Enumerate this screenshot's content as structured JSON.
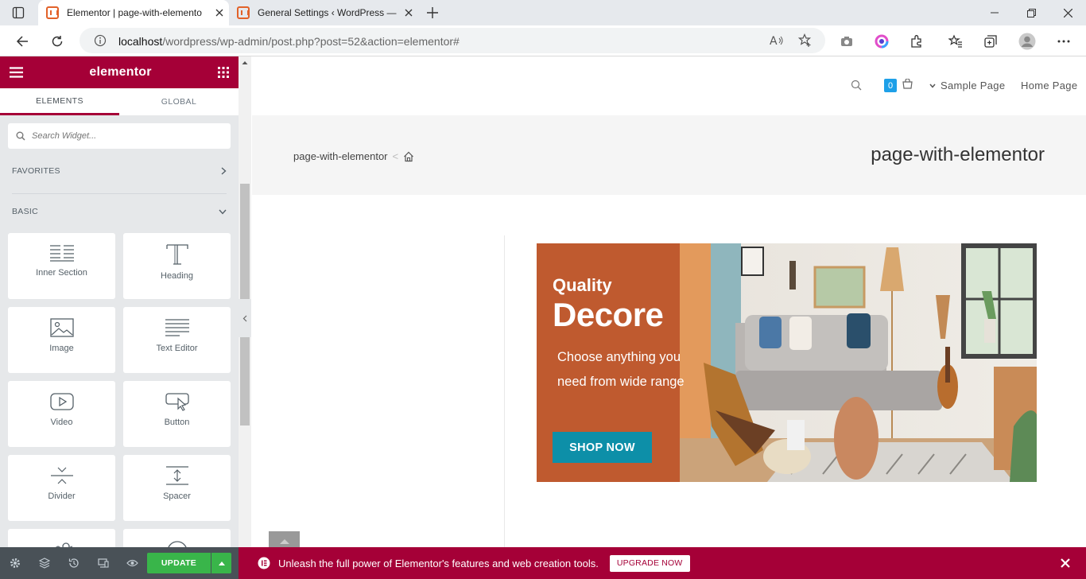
{
  "browser": {
    "tabs": [
      {
        "title": "Elementor | page-with-elemento",
        "active": true
      },
      {
        "title": "General Settings ‹ WordPress — W",
        "active": false
      }
    ],
    "url_host": "localhost",
    "url_rest": "/wordpress/wp-admin/post.php?post=52&action=elementor#"
  },
  "panel": {
    "brand": "elementor",
    "tabs": [
      "ELEMENTS",
      "GLOBAL"
    ],
    "search_placeholder": "Search Widget...",
    "categories": {
      "favorites": "FAVORITES",
      "basic": "BASIC"
    },
    "widgets": [
      "Inner Section",
      "Heading",
      "Image",
      "Text Editor",
      "Video",
      "Button",
      "Divider",
      "Spacer"
    ],
    "update_label": "UPDATE"
  },
  "site": {
    "cart_count": "0",
    "nav": [
      "Sample Page",
      "Home Page"
    ],
    "breadcrumb": "page-with-elementor",
    "breadcrumb_sep": "<",
    "page_title": "page-with-elementor"
  },
  "banner": {
    "kicker": "Quality",
    "headline": "Decore",
    "text": "Choose anything you need from wide range",
    "cta": "SHOP NOW"
  },
  "promo": {
    "text": "Unleash the full power of Elementor's features and web creation tools.",
    "cta": "UPGRADE NOW"
  },
  "colors": {
    "accent": "#a50037",
    "update": "#39b54a",
    "banner_left": "#bf5a2f",
    "cta": "#0d8fa8"
  }
}
